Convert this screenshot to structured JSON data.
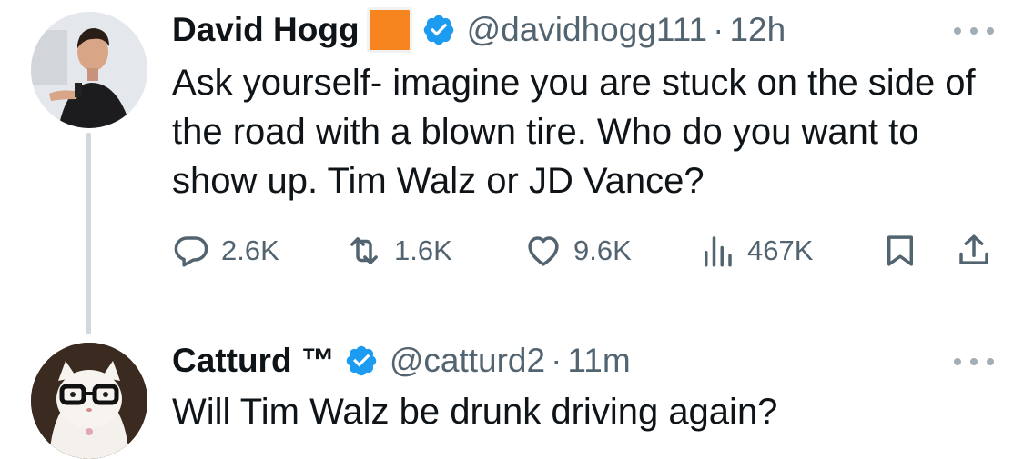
{
  "tweets": [
    {
      "display_name": "David Hogg",
      "flag_emoji": "orange-square-emoji",
      "verified": true,
      "handle": "@davidhogg111",
      "separator": "·",
      "time": "12h",
      "text": "Ask yourself- imagine you are stuck on the side of the road with a blown tire. Who do you want to show up. Tim Walz or JD Vance?",
      "stats": {
        "replies": "2.6K",
        "reposts": "1.6K",
        "likes": "9.6K",
        "views": "467K"
      }
    },
    {
      "display_name": "Catturd ™",
      "verified": true,
      "handle": "@catturd2",
      "separator": "·",
      "time": "11m",
      "text": "Will Tim Walz be drunk driving again?"
    }
  ],
  "icons": {
    "more": "more-horizontal-icon",
    "reply": "reply-bubble-icon",
    "repost": "repost-icon",
    "like": "heart-icon",
    "views": "views-bar-chart-icon",
    "bookmark": "bookmark-icon",
    "share": "share-upload-icon",
    "verified": "verified-badge-icon"
  },
  "colors": {
    "primary_text": "#0f1419",
    "secondary_text": "#536471",
    "verified_blue": "#1d9bf0",
    "thread_line": "#cfd9de",
    "flag_orange": "#f6841f"
  }
}
